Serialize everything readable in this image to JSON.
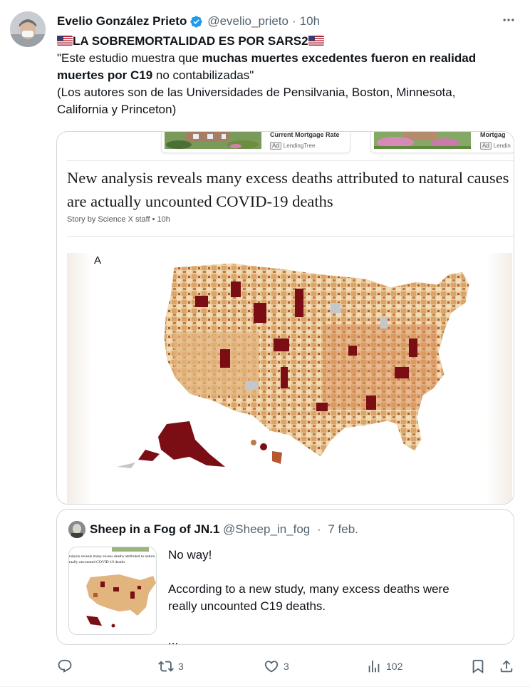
{
  "colors": {
    "text": "#0f1419",
    "secondary": "#536471",
    "border": "#cfd9de",
    "verified": "#1d9bf0",
    "map_dark": "#7b0d14",
    "map_mid": "#c9935a",
    "map_light": "#f2dcb8"
  },
  "tweet": {
    "author_name": "Evelio González Prieto",
    "handle": "@evelio_prieto",
    "separator": "·",
    "time": "10h",
    "more_icon": "more-icon",
    "title_text": "LA SOBREMORTALIDAD ES POR SARS2",
    "quote_open": "\"Este estudio muestra que ",
    "quote_bold1": "muchas muertes excedentes fueron en realidad",
    "quote_bold2": "muertes por C19",
    "quote_close": " no contabilizadas\"",
    "note_line1": "(Los autores son de las Universidades de Pensilvania, Boston, Minnesota,",
    "note_line2": "California y Princeton)"
  },
  "media": {
    "ads": [
      {
        "title": "Current Mortgage Rate",
        "ad_label": "Ad",
        "sponsor": "LendingTree"
      },
      {
        "title": "Mortgag",
        "ad_label": "Ad",
        "sponsor": "Lendin"
      }
    ],
    "headline": "New analysis reveals many excess deaths attributed to natural causes are actually uncounted COVID-19 deaths",
    "byline": "Story by Science X staff •  10h",
    "map_letter": "A"
  },
  "quote": {
    "author_name": "Sheep in a Fog of JN.1",
    "handle": "@Sheep_in_fog",
    "separator": "·",
    "time": "7 feb.",
    "text1": "No way!",
    "text2a": "According to a new study, many excess deaths were",
    "text2b": "really uncounted C19 deaths.",
    "text3": "...",
    "thumb_line1": "nalysis reveals many excess deaths attributed to natura",
    "thumb_line2": "tually uncounted COVID-19 deaths"
  },
  "actions": {
    "reply": {
      "icon": "reply-icon",
      "count": ""
    },
    "retweet": {
      "icon": "retweet-icon",
      "count": "3"
    },
    "like": {
      "icon": "heart-icon",
      "count": "3"
    },
    "views": {
      "icon": "views-icon",
      "count": "102"
    },
    "bookmark": {
      "icon": "bookmark-icon"
    },
    "share": {
      "icon": "share-icon"
    }
  }
}
